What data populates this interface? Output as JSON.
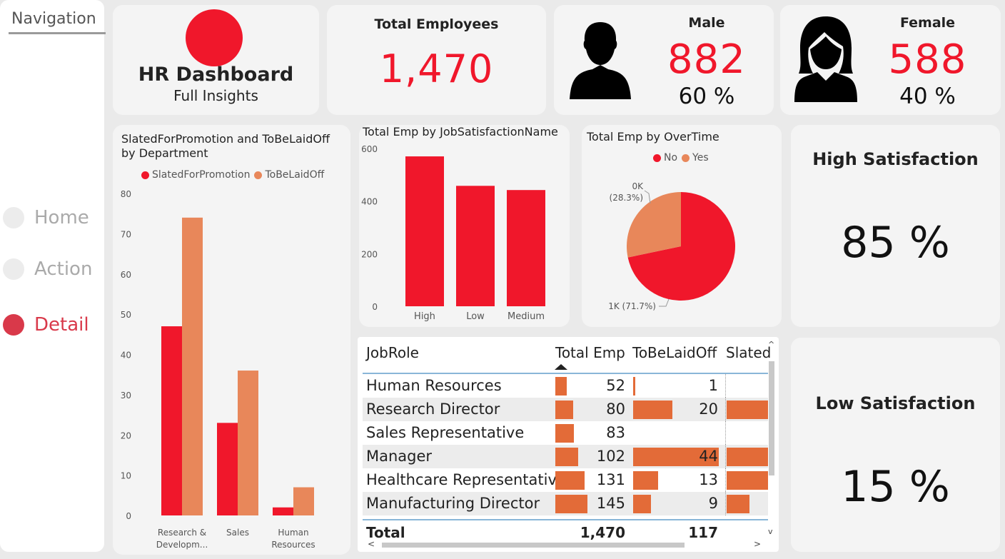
{
  "nav": {
    "title": "Navigation",
    "items": [
      {
        "label": "Home",
        "active": false
      },
      {
        "label": "Action",
        "active": false
      },
      {
        "label": "Detail",
        "active": true
      }
    ]
  },
  "header": {
    "title": "HR Dashboard",
    "subtitle": "Full Insights"
  },
  "kpi": {
    "total_label": "Total Employees",
    "total_value": "1,470",
    "male_label": "Male",
    "male_value": "882",
    "male_pct": "60 %",
    "female_label": "Female",
    "female_value": "588",
    "female_pct": "40 %",
    "high_label": "High Satisfaction",
    "high_value": "85 %",
    "low_label": "Low Satisfaction",
    "low_value": "15 %"
  },
  "colors": {
    "red": "#f0172b",
    "orange": "#e8875a",
    "accent": "#d9394a"
  },
  "charts": {
    "dept": {
      "title_line1": "SlatedForPromotion and ToBeLaidOff",
      "title_line2": "by Department",
      "legend1": "SlatedForPromotion",
      "legend2": "ToBeLaidOff"
    },
    "jobsat": {
      "title": "Total Emp by JobSatisfactionName"
    },
    "overtime": {
      "title": "Total Emp by OverTime",
      "legend1": "No",
      "legend2": "Yes",
      "label_yes_1": "0K",
      "label_yes_2": "(28.3%)",
      "label_no": "1K (71.7%)"
    }
  },
  "chart_data": [
    {
      "type": "bar",
      "title": "SlatedForPromotion and ToBeLaidOff by Department",
      "categories": [
        "Research & Developm...",
        "Sales",
        "Human Resources"
      ],
      "series": [
        {
          "name": "SlatedForPromotion",
          "values": [
            47,
            23,
            2
          ]
        },
        {
          "name": "ToBeLaidOff",
          "values": [
            74,
            36,
            7
          ]
        }
      ],
      "yticks": [
        0,
        10,
        20,
        30,
        40,
        50,
        60,
        70,
        80
      ],
      "ylim": [
        0,
        80
      ]
    },
    {
      "type": "bar",
      "title": "Total Emp by JobSatisfactionName",
      "categories": [
        "High",
        "Low",
        "Medium"
      ],
      "values": [
        570,
        458,
        442
      ],
      "yticks": [
        0,
        200,
        400,
        600
      ],
      "ylim": [
        0,
        600
      ]
    },
    {
      "type": "pie",
      "title": "Total Emp by OverTime",
      "labels": [
        "No",
        "Yes"
      ],
      "values": [
        71.7,
        28.3
      ]
    }
  ],
  "table": {
    "headers": [
      "JobRole",
      "Total Emp",
      "ToBeLaidOff",
      "Slated"
    ],
    "rows": [
      {
        "role": "Human Resources",
        "total": "52",
        "laid": "1",
        "slated": 0
      },
      {
        "role": "Research Director",
        "total": "80",
        "laid": "20",
        "slated": 1
      },
      {
        "role": "Sales Representative",
        "total": "83",
        "laid": "",
        "slated": 0
      },
      {
        "role": "Manager",
        "total": "102",
        "laid": "44",
        "slated": 1
      },
      {
        "role": "Healthcare Representative",
        "total": "131",
        "laid": "13",
        "slated": 1
      },
      {
        "role": "Manufacturing Director",
        "total": "145",
        "laid": "9",
        "slated": 0.55
      }
    ],
    "total_label": "Total",
    "total_emp": "1,470",
    "total_laid": "117"
  }
}
